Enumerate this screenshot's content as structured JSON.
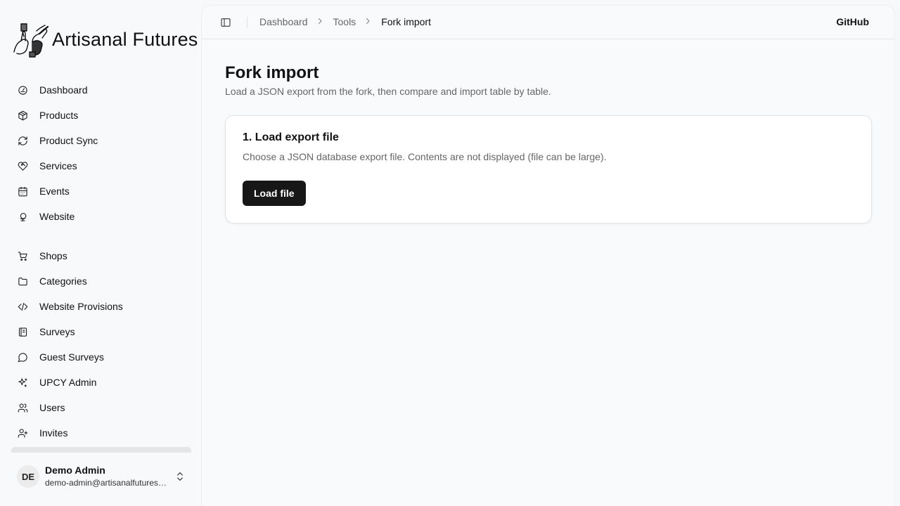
{
  "app": {
    "logo_text": "Artisanal Futures",
    "logo_icon": "hands-with-tools-logo"
  },
  "sidebar": {
    "primary": [
      {
        "label": "Dashboard",
        "icon": "gauge-icon"
      },
      {
        "label": "Products",
        "icon": "package-icon"
      },
      {
        "label": "Product Sync",
        "icon": "refresh-icon"
      },
      {
        "label": "Services",
        "icon": "heart-handshake-icon"
      },
      {
        "label": "Events",
        "icon": "calendar-icon"
      },
      {
        "label": "Website",
        "icon": "globe-stand-icon"
      }
    ],
    "secondary": [
      {
        "label": "Shops",
        "icon": "shopping-cart-icon"
      },
      {
        "label": "Categories",
        "icon": "folder-icon"
      },
      {
        "label": "Website Provisions",
        "icon": "code-icon"
      },
      {
        "label": "Surveys",
        "icon": "notebook-icon"
      },
      {
        "label": "Guest Surveys",
        "icon": "message-circle-icon"
      },
      {
        "label": "UPCY Admin",
        "icon": "sparkles-icon"
      },
      {
        "label": "Users",
        "icon": "users-icon"
      },
      {
        "label": "Invites",
        "icon": "user-plus-icon"
      }
    ],
    "user": {
      "initials": "DE",
      "name": "Demo Admin",
      "email": "demo-admin@artisanalfutures.org"
    }
  },
  "topbar": {
    "toggle_icon": "sidebar-panel-icon",
    "breadcrumb": [
      "Dashboard",
      "Tools",
      "Fork import"
    ],
    "github_label": "GitHub"
  },
  "main": {
    "title": "Fork import",
    "subtitle": "Load a JSON export from the fork, then compare and import table by table.",
    "card": {
      "title": "1. Load export file",
      "description": "Choose a JSON database export file. Contents are not displayed (file can be large).",
      "button_label": "Load file"
    }
  },
  "colors": {
    "background": "#f7f8f9",
    "primary_button": "#171717",
    "muted_text": "#666666"
  }
}
